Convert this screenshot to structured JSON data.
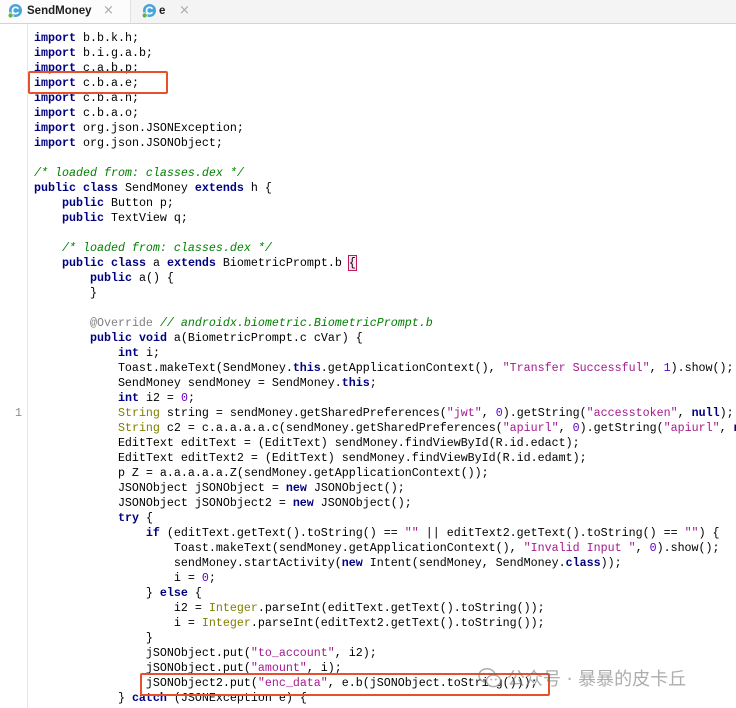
{
  "tabs": [
    {
      "label": "SendMoney",
      "icon": "class-icon",
      "close": "×",
      "active": true
    },
    {
      "label": "e",
      "icon": "class-icon",
      "close": "×",
      "active": false
    }
  ],
  "theme": {
    "keyword": "#000080",
    "string": "#a31b8e",
    "number": "#6400c8",
    "comment": "#008000",
    "annotation": "#808080",
    "type": "#808000",
    "text": "#000000",
    "matched_brace": "#c2185b",
    "highlight_box": "#e8502c"
  },
  "code": {
    "lines": [
      {
        "tokens": [
          [
            "import",
            "kw"
          ],
          [
            " b.b.k.h;",
            "txt"
          ]
        ]
      },
      {
        "tokens": [
          [
            "import",
            "kw"
          ],
          [
            " b.i.g.a.b;",
            "txt"
          ]
        ]
      },
      {
        "tokens": [
          [
            "import",
            "kw"
          ],
          [
            " c.a.b.p;",
            "txt"
          ]
        ]
      },
      {
        "tokens": [
          [
            "import",
            "kw"
          ],
          [
            " c.b.a.e;",
            "txt"
          ]
        ]
      },
      {
        "tokens": [
          [
            "import",
            "kw"
          ],
          [
            " c.b.a.n;",
            "txt"
          ]
        ]
      },
      {
        "tokens": [
          [
            "import",
            "kw"
          ],
          [
            " c.b.a.o;",
            "txt"
          ]
        ]
      },
      {
        "tokens": [
          [
            "import",
            "kw"
          ],
          [
            " org.json.JSONException;",
            "txt"
          ]
        ]
      },
      {
        "tokens": [
          [
            "import",
            "kw"
          ],
          [
            " org.json.JSONObject;",
            "txt"
          ]
        ]
      },
      {
        "tokens": []
      },
      {
        "tokens": [
          [
            "/* loaded from: classes.dex */",
            "cmt"
          ]
        ]
      },
      {
        "tokens": [
          [
            "public",
            "kw"
          ],
          [
            " ",
            "txt"
          ],
          [
            "class",
            "kw"
          ],
          [
            " SendMoney ",
            "txt"
          ],
          [
            "extends",
            "kw"
          ],
          [
            " h {",
            "txt"
          ]
        ]
      },
      {
        "tokens": [
          [
            "    ",
            "txt"
          ],
          [
            "public",
            "kw"
          ],
          [
            " Button p;",
            "txt"
          ]
        ]
      },
      {
        "tokens": [
          [
            "    ",
            "txt"
          ],
          [
            "public",
            "kw"
          ],
          [
            " TextView q;",
            "txt"
          ]
        ]
      },
      {
        "tokens": []
      },
      {
        "tokens": [
          [
            "    ",
            "txt"
          ],
          [
            "/* loaded from: classes.dex */",
            "cmt"
          ]
        ]
      },
      {
        "tokens": [
          [
            "    ",
            "txt"
          ],
          [
            "public",
            "kw"
          ],
          [
            " ",
            "txt"
          ],
          [
            "class",
            "kw"
          ],
          [
            " a ",
            "txt"
          ],
          [
            "extends",
            "kw"
          ],
          [
            " BiometricPrompt.b ",
            "txt"
          ],
          [
            "{",
            "brace"
          ]
        ]
      },
      {
        "tokens": [
          [
            "        ",
            "txt"
          ],
          [
            "public",
            "kw"
          ],
          [
            " a() {",
            "txt"
          ]
        ]
      },
      {
        "tokens": [
          [
            "        }",
            "txt"
          ]
        ]
      },
      {
        "tokens": []
      },
      {
        "tokens": [
          [
            "        ",
            "txt"
          ],
          [
            "@Override",
            "ann"
          ],
          [
            " ",
            "txt"
          ],
          [
            "// androidx.biometric.BiometricPrompt.b",
            "cmt"
          ]
        ]
      },
      {
        "tokens": [
          [
            "        ",
            "txt"
          ],
          [
            "public",
            "kw"
          ],
          [
            " ",
            "txt"
          ],
          [
            "void",
            "kw"
          ],
          [
            " a(BiometricPrompt.c cVar) {",
            "txt"
          ]
        ]
      },
      {
        "tokens": [
          [
            "            ",
            "txt"
          ],
          [
            "int",
            "kw"
          ],
          [
            " i;",
            "txt"
          ]
        ]
      },
      {
        "tokens": [
          [
            "            Toast.makeText(SendMoney.",
            "txt"
          ],
          [
            "this",
            "kw"
          ],
          [
            ".getApplicationContext(), ",
            "txt"
          ],
          [
            "\"Transfer Successful\"",
            "str"
          ],
          [
            ", ",
            "txt"
          ],
          [
            "1",
            "num"
          ],
          [
            ").show();",
            "txt"
          ]
        ]
      },
      {
        "tokens": [
          [
            "            SendMoney sendMoney = SendMoney.",
            "txt"
          ],
          [
            "this",
            "kw"
          ],
          [
            ";",
            "txt"
          ]
        ]
      },
      {
        "tokens": [
          [
            "            ",
            "txt"
          ],
          [
            "int",
            "kw"
          ],
          [
            " i2 = ",
            "txt"
          ],
          [
            "0",
            "num"
          ],
          [
            ";",
            "txt"
          ]
        ]
      },
      {
        "gutter": "1",
        "tokens": [
          [
            "            ",
            "txt"
          ],
          [
            "String",
            "type"
          ],
          [
            " string = sendMoney.getSharedPreferences(",
            "txt"
          ],
          [
            "\"jwt\"",
            "str"
          ],
          [
            ", ",
            "txt"
          ],
          [
            "0",
            "num"
          ],
          [
            ").getString(",
            "txt"
          ],
          [
            "\"accesstoken\"",
            "str"
          ],
          [
            ", ",
            "txt"
          ],
          [
            "null",
            "kw"
          ],
          [
            ");",
            "txt"
          ]
        ]
      },
      {
        "tokens": [
          [
            "            ",
            "txt"
          ],
          [
            "String",
            "type"
          ],
          [
            " c2 = c.a.a.a.a.c(sendMoney.getSharedPreferences(",
            "txt"
          ],
          [
            "\"apiurl\"",
            "str"
          ],
          [
            ", ",
            "txt"
          ],
          [
            "0",
            "num"
          ],
          [
            ").getString(",
            "txt"
          ],
          [
            "\"apiurl\"",
            "str"
          ],
          [
            ", ",
            "txt"
          ],
          [
            "n",
            "kw"
          ]
        ]
      },
      {
        "tokens": [
          [
            "            EditText editText = (EditText) sendMoney.findViewById(R.id.edact);",
            "txt"
          ]
        ]
      },
      {
        "tokens": [
          [
            "            EditText editText2 = (EditText) sendMoney.findViewById(R.id.edamt);",
            "txt"
          ]
        ]
      },
      {
        "tokens": [
          [
            "            p Z = a.a.a.a.a.Z(sendMoney.getApplicationContext());",
            "txt"
          ]
        ]
      },
      {
        "tokens": [
          [
            "            JSONObject jSONObject = ",
            "txt"
          ],
          [
            "new",
            "kw"
          ],
          [
            " JSONObject();",
            "txt"
          ]
        ]
      },
      {
        "tokens": [
          [
            "            JSONObject jSONObject2 = ",
            "txt"
          ],
          [
            "new",
            "kw"
          ],
          [
            " JSONObject();",
            "txt"
          ]
        ]
      },
      {
        "tokens": [
          [
            "            ",
            "txt"
          ],
          [
            "try",
            "kw"
          ],
          [
            " {",
            "txt"
          ]
        ]
      },
      {
        "tokens": [
          [
            "                ",
            "txt"
          ],
          [
            "if",
            "kw"
          ],
          [
            " (editText.getText().toString() == ",
            "txt"
          ],
          [
            "\"\"",
            "str"
          ],
          [
            " || editText2.getText().toString() == ",
            "txt"
          ],
          [
            "\"\"",
            "str"
          ],
          [
            ") {",
            "txt"
          ]
        ]
      },
      {
        "tokens": [
          [
            "                    Toast.makeText(sendMoney.getApplicationContext(), ",
            "txt"
          ],
          [
            "\"Invalid Input \"",
            "str"
          ],
          [
            ", ",
            "txt"
          ],
          [
            "0",
            "num"
          ],
          [
            ").show();",
            "txt"
          ]
        ]
      },
      {
        "tokens": [
          [
            "                    sendMoney.startActivity(",
            "txt"
          ],
          [
            "new",
            "kw"
          ],
          [
            " Intent(sendMoney, SendMoney.",
            "txt"
          ],
          [
            "class",
            "kw"
          ],
          [
            "));",
            "txt"
          ]
        ]
      },
      {
        "tokens": [
          [
            "                    i = ",
            "txt"
          ],
          [
            "0",
            "num"
          ],
          [
            ";",
            "txt"
          ]
        ]
      },
      {
        "tokens": [
          [
            "                } ",
            "txt"
          ],
          [
            "else",
            "kw"
          ],
          [
            " {",
            "txt"
          ]
        ]
      },
      {
        "tokens": [
          [
            "                    i2 = ",
            "txt"
          ],
          [
            "Integer",
            "type"
          ],
          [
            ".parseInt(editText.getText().toString());",
            "txt"
          ]
        ]
      },
      {
        "tokens": [
          [
            "                    i = ",
            "txt"
          ],
          [
            "Integer",
            "type"
          ],
          [
            ".parseInt(editText2.getText().toString());",
            "txt"
          ]
        ]
      },
      {
        "tokens": [
          [
            "                }",
            "txt"
          ]
        ]
      },
      {
        "tokens": [
          [
            "                jSONObject.put(",
            "txt"
          ],
          [
            "\"to_account\"",
            "str"
          ],
          [
            ", i2);",
            "txt"
          ]
        ]
      },
      {
        "tokens": [
          [
            "                jSONObject.put(",
            "txt"
          ],
          [
            "\"amount\"",
            "str"
          ],
          [
            ", i);",
            "txt"
          ]
        ]
      },
      {
        "tokens": [
          [
            "                jSONObject2.put(",
            "txt"
          ],
          [
            "\"enc_data\"",
            "str"
          ],
          [
            ", e.b(jSONObject.toString()));",
            "txt"
          ]
        ]
      },
      {
        "tokens": [
          [
            "            } ",
            "txt"
          ],
          [
            "catch",
            "kw"
          ],
          [
            " (JSONException e) {",
            "txt"
          ]
        ]
      }
    ]
  },
  "watermark": {
    "icon": "wechat-icon",
    "text": "公众号 · 暴暴的皮卡丘"
  }
}
